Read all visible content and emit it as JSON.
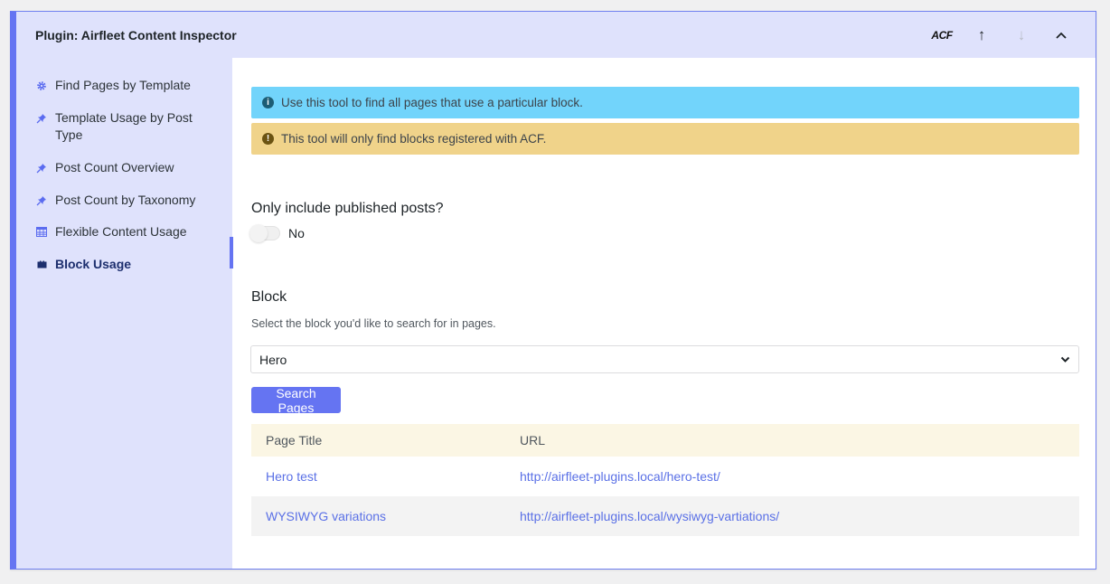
{
  "header": {
    "title": "Plugin: Airfleet Content Inspector",
    "acf_logo": "ACF"
  },
  "colors": {
    "accent": "#6574f2",
    "panel_bg": "#dfe2fc",
    "info": "#72d4fb",
    "warn": "#f0d38a",
    "link": "#5a70e6"
  },
  "sidebar": {
    "items": [
      {
        "label": "Find Pages by Template",
        "icon": "gear-icon"
      },
      {
        "label": "Template Usage by Post Type",
        "icon": "pin-icon"
      },
      {
        "label": "Post Count Overview",
        "icon": "pin-icon"
      },
      {
        "label": "Post Count by Taxonomy",
        "icon": "pin-icon"
      },
      {
        "label": "Flexible Content Usage",
        "icon": "table-icon"
      },
      {
        "label": "Block Usage",
        "icon": "block-icon",
        "active": true
      }
    ]
  },
  "main": {
    "notices": {
      "info": "Use this tool to find all pages that use a particular block.",
      "warning": "This tool will only find blocks registered with ACF."
    },
    "published": {
      "label": "Only include published posts?",
      "value": "No"
    },
    "block": {
      "label": "Block",
      "hint": "Select the block you'd like to search for in pages.",
      "selected": "Hero"
    },
    "search_button": "Search Pages",
    "table": {
      "columns": [
        "Page Title",
        "URL"
      ],
      "rows": [
        {
          "title": "Hero test",
          "url": "http://airfleet-plugins.local/hero-test/"
        },
        {
          "title": "WYSIWYG variations",
          "url": "http://airfleet-plugins.local/wysiwyg-vartiations/"
        }
      ]
    }
  }
}
